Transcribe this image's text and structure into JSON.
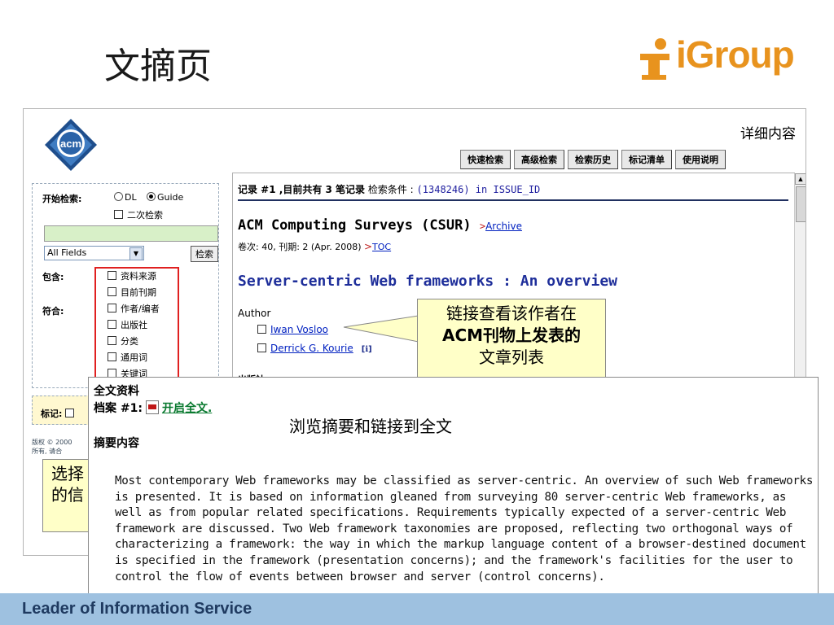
{
  "slide_title": "文摘页",
  "logo_text": "iGroup",
  "screenshot": {
    "page_title": "详细内容",
    "toolbar": [
      "快速检索",
      "高级检索",
      "检索历史",
      "标记清单",
      "使用说明"
    ],
    "search_panel": {
      "start_label": "开始检索:",
      "radio_dl": "DL",
      "radio_guide": "Guide",
      "secondary": "二次检索",
      "field_select": "All Fields",
      "search_button": "检索",
      "contains_label": "包含:",
      "match_label": "符合:",
      "options": [
        "资料来源",
        "目前刊期",
        "作者/编者",
        "出版社",
        "分类",
        "通用词",
        "关键词"
      ]
    },
    "mark_label": "标记:",
    "copyright": [
      "版权 © 2000",
      "所有, 请合"
    ],
    "record": {
      "prefix": "记录 #1 ,目前共有 3 笔记录",
      "criteria_label": "检索条件 :",
      "criteria_value": "(1348246) in ISSUE_ID"
    },
    "journal": {
      "name": "ACM Computing Surveys (CSUR)",
      "archive_link": "Archive",
      "volume": "卷次: 40,  刊期: 2  (Apr. 2008)",
      "toc_link": "TOC"
    },
    "article_title": "Server-centric Web frameworks : An overview",
    "author_label": "Author",
    "authors": [
      "Iwan Vosloo",
      "Derrick G. Kourie"
    ],
    "publisher_label": "出版社"
  },
  "callouts": {
    "author": [
      "链接查看该作者在",
      "ACM刊物上发表的",
      "文章列表"
    ],
    "select": [
      "选择",
      "的信"
    ]
  },
  "overlay": {
    "fulltext_title": "全文资料",
    "file_label": "档案  #1:",
    "open_link": "开启全文.",
    "browse_label": "浏览摘要和链接到全文",
    "abstract_title": "摘要内容",
    "abstract": "Most contemporary Web frameworks may be classified as server-centric. An overview of such Web frameworks is presented. It is based on information gleaned from surveying 80 server-centric Web frameworks, as well as from popular related specifications. Requirements typically expected of a server-centric Web framework are discussed. Two Web framework taxonomies are proposed, reflecting two orthogonal ways of characterizing a framework: the way in which the markup language content of a browser-destined document is specified in the framework (presentation concerns); and the framework's facilities for the user to control the flow of events between browser and server (control concerns)."
  },
  "footer_text": "Leader of Information Service",
  "colors": {
    "accent_orange": "#e8931e",
    "title_blue": "#1e2e9a",
    "footer_bg": "#9ec1e0",
    "callout_bg": "#ffffc8",
    "highlight_red": "#e02020"
  }
}
